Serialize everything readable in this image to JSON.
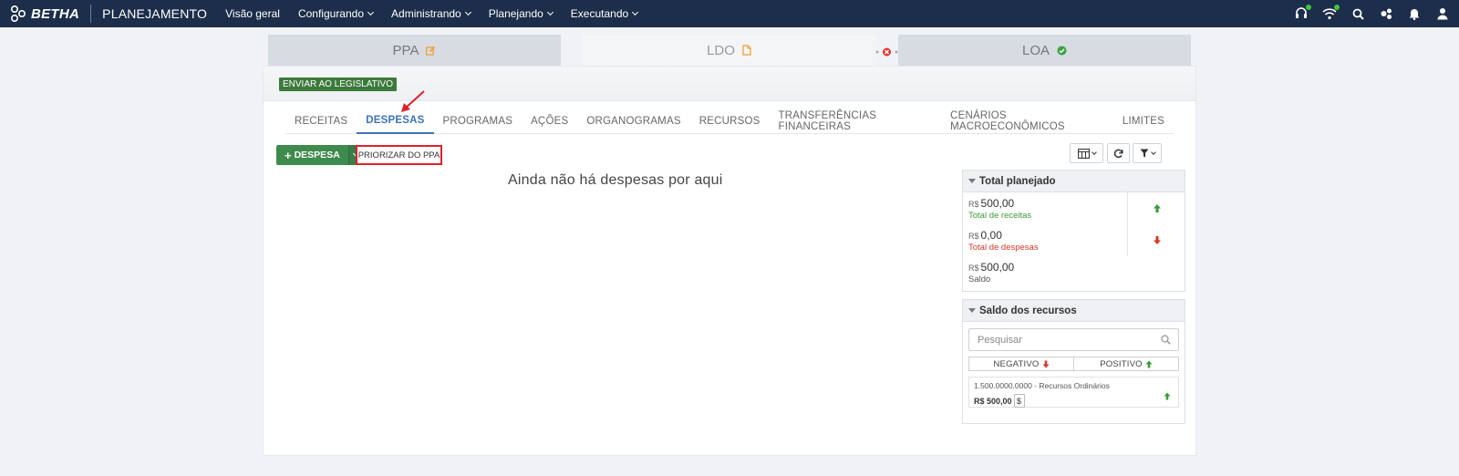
{
  "brand": {
    "name": "BETHA",
    "app": "PLANEJAMENTO"
  },
  "nav": [
    {
      "label": "Visão geral",
      "dropdown": false
    },
    {
      "label": "Configurando",
      "dropdown": true
    },
    {
      "label": "Administrando",
      "dropdown": true
    },
    {
      "label": "Planejando",
      "dropdown": true
    },
    {
      "label": "Executando",
      "dropdown": true
    }
  ],
  "top_icons": [
    "headset-icon",
    "wifi-icon",
    "search-icon",
    "users-gear-icon",
    "bell-icon",
    "user-icon"
  ],
  "stages": {
    "ppa": {
      "label": "PPA",
      "icon": "edit-icon"
    },
    "ldo": {
      "label": "LDO",
      "icon": "document-icon"
    },
    "loa": {
      "label": "LOA",
      "icon": "check-circle-icon"
    }
  },
  "actions": {
    "send": "ENVIAR AO LEGISLATIVO"
  },
  "subtabs": [
    {
      "label": "RECEITAS",
      "active": false
    },
    {
      "label": "DESPESAS",
      "active": true
    },
    {
      "label": "PROGRAMAS",
      "active": false
    },
    {
      "label": "AÇÕES",
      "active": false
    },
    {
      "label": "ORGANOGRAMAS",
      "active": false
    },
    {
      "label": "RECURSOS",
      "active": false
    },
    {
      "label": "TRANSFERÊNCIAS FINANCEIRAS",
      "active": false
    },
    {
      "label": "CENÁRIOS MACROECONÔMICOS",
      "active": false
    },
    {
      "label": "LIMITES",
      "active": false
    }
  ],
  "toolbar": {
    "add_label": "DESPESA",
    "priorize_label": "PRIORIZAR DO PPA"
  },
  "empty_message": "Ainda não há despesas por aqui",
  "total_planejado": {
    "title": "Total planejado",
    "currency": "R$",
    "rows": [
      {
        "value": "500,00",
        "label": "Total de receitas",
        "color": "green",
        "arrow": "up"
      },
      {
        "value": "0,00",
        "label": "Total de despesas",
        "color": "red",
        "arrow": "down"
      },
      {
        "value": "500,00",
        "label": "Saldo",
        "color": "gray",
        "arrow": ""
      }
    ]
  },
  "saldo_recursos": {
    "title": "Saldo dos recursos",
    "search_placeholder": "Pesquisar",
    "filter_negative": "NEGATIVO",
    "filter_positive": "POSITIVO",
    "items": [
      {
        "name": "1.500.0000.0000 - Recursos Ordinários",
        "value": "R$ 500,00",
        "dollar": "$"
      }
    ]
  },
  "colors": {
    "topbar": "#1c2e4a",
    "green": "#3f8a4d",
    "active_tab": "#3b73b9",
    "highlight_red": "#e0202a"
  }
}
